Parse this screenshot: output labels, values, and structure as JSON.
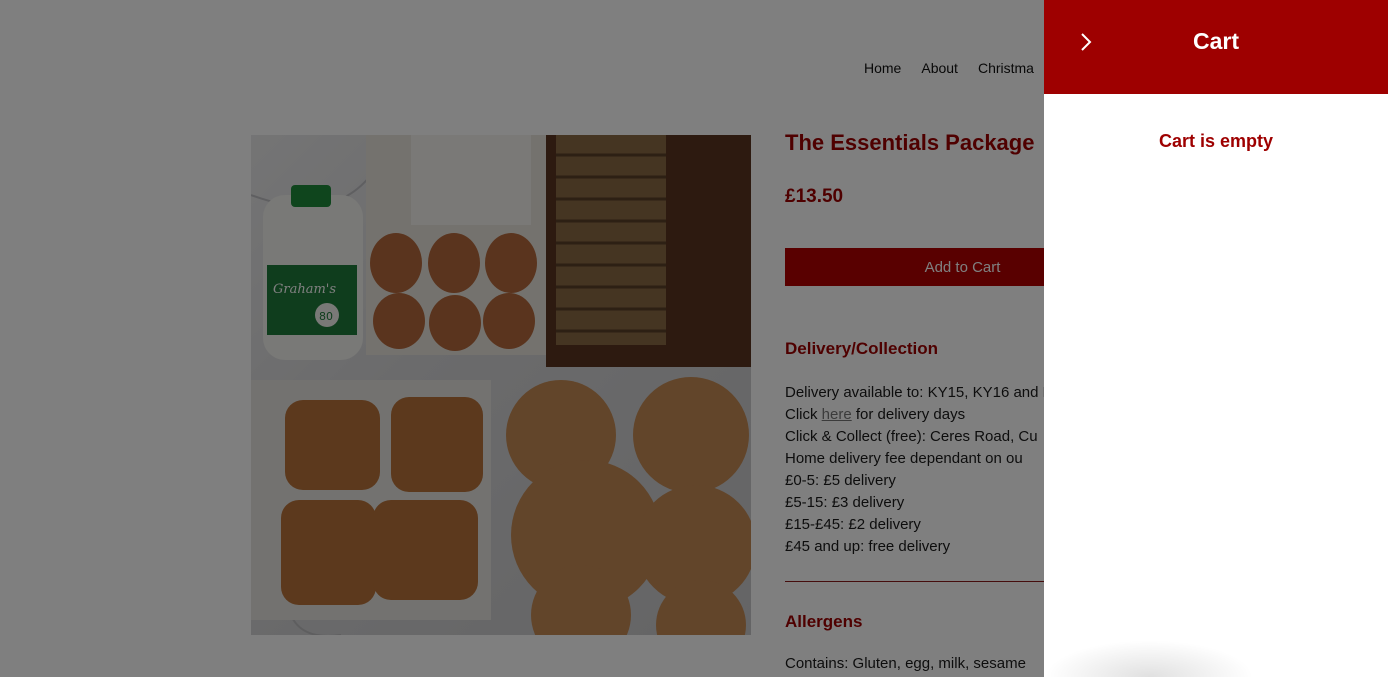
{
  "nav": {
    "items": [
      "Home",
      "About",
      "Christma"
    ]
  },
  "product": {
    "title": "The Essentials Package",
    "price": "£13.50",
    "add_to_cart_label": "Add to Cart",
    "image_brand_text": "Graham's",
    "image_badge_text": "80"
  },
  "delivery": {
    "heading": "Delivery/Collection",
    "line1": "Delivery available to: KY15, KY16 and D",
    "line2_prefix": "Click ",
    "line2_link": "here",
    "line2_suffix": " for delivery days",
    "line3": "Click & Collect (free): Ceres Road, Cu",
    "line4": "Home delivery fee dependant on ou",
    "tiers": [
      "£0-5: £5 delivery",
      "£5-15: £3 delivery",
      "£15-£45: £2 delivery",
      "£45 and up: free delivery"
    ]
  },
  "allergens": {
    "heading": "Allergens",
    "text": "Contains: Gluten, egg, milk, sesame"
  },
  "cart": {
    "title": "Cart",
    "empty_text": "Cart is empty",
    "close_icon": "chevron-right-icon"
  },
  "colors": {
    "brand_red": "#9e0000",
    "button_red": "#b30000",
    "overlay": "rgba(0,0,0,0.5)"
  }
}
